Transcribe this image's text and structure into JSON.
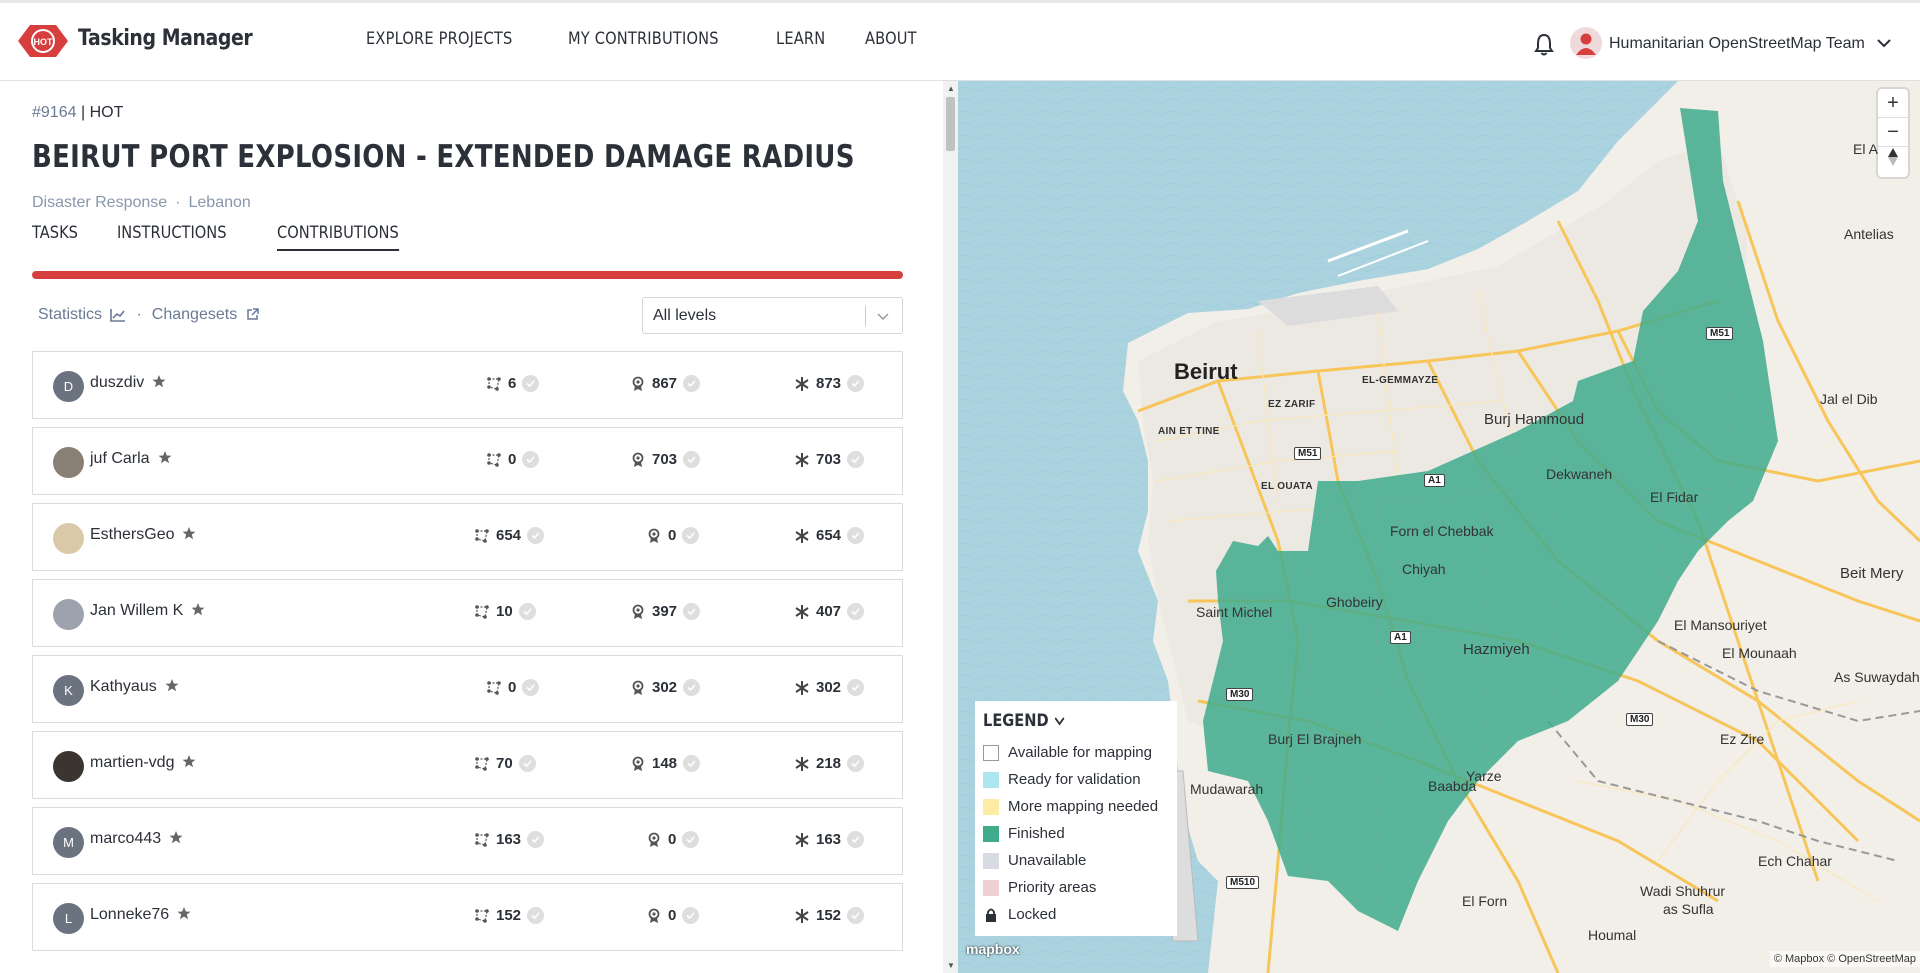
{
  "app": {
    "brand": "Tasking Manager",
    "logo_text": "HOT",
    "nav": [
      "EXPLORE PROJECTS",
      "MY CONTRIBUTIONS",
      "LEARN",
      "ABOUT"
    ],
    "user_name": "Humanitarian OpenStreetMap Team"
  },
  "project": {
    "id": "#9164",
    "org": "HOT",
    "title": "BEIRUT PORT EXPLOSION - EXTENDED DAMAGE RADIUS",
    "type": "Disaster Response",
    "country": "Lebanon",
    "tabs": [
      "TASKS",
      "INSTRUCTIONS",
      "CONTRIBUTIONS"
    ],
    "active_tab": "CONTRIBUTIONS",
    "progress_color": "#d73f3f"
  },
  "contrib": {
    "statistics_label": "Statistics",
    "changesets_label": "Changesets",
    "level_select": "All levels",
    "rows": [
      {
        "name": "duszdiv",
        "initial": "D",
        "mapped": "6",
        "validated": "867",
        "total": "873"
      },
      {
        "name": "juf Carla",
        "initial": "",
        "mapped": "0",
        "validated": "703",
        "total": "703"
      },
      {
        "name": "EsthersGeo",
        "initial": "",
        "mapped": "654",
        "validated": "0",
        "total": "654"
      },
      {
        "name": "Jan Willem K",
        "initial": "",
        "mapped": "10",
        "validated": "397",
        "total": "407"
      },
      {
        "name": "Kathyaus",
        "initial": "K",
        "mapped": "0",
        "validated": "302",
        "total": "302"
      },
      {
        "name": "martien-vdg",
        "initial": "",
        "mapped": "70",
        "validated": "148",
        "total": "218"
      },
      {
        "name": "marco443",
        "initial": "M",
        "mapped": "163",
        "validated": "0",
        "total": "163"
      },
      {
        "name": "Lonneke76",
        "initial": "L",
        "mapped": "152",
        "validated": "0",
        "total": "152"
      }
    ]
  },
  "map": {
    "labels": {
      "beirut": "Beirut",
      "ez_zarif": "EZ ZARIF",
      "el_gemmayze": "EL-GEMMAYZE",
      "ain_et_tine": "AIN ET TINE",
      "el_ouata": "EL OUATA",
      "burj_hammoud": "Burj Hammoud",
      "dekwaneh": "Dekwaneh",
      "el_fidar": "El Fidar",
      "forn_el_chebbak": "Forn el Chebbak",
      "chiyah": "Chiyah",
      "ghobeiry": "Ghobeiry",
      "saint_michel": "Saint Michel",
      "hazmiyeh": "Hazmiyeh",
      "el_mansouriyet": "El Mansouriyet",
      "el_mounaah": "El Mounaah",
      "beit_mery": "Beit Mery",
      "as_suwaydah": "As Suwaydah",
      "ez_zire": "Ez Zire",
      "burj_el_brajneh": "Burj El Brajneh",
      "yarze": "Yarze",
      "baabda": "Baabda",
      "mudawarah": "Mudawarah",
      "ech_chahar": "Ech Chahar",
      "wadi_shuhrur": "Wadi Shuhrur",
      "as_sufla": "as Sufla",
      "el_forn": "El Forn",
      "houmal": "Houmal",
      "antelias": "Antelias",
      "jal_el_dib": "Jal el Dib",
      "el_a": "El A"
    },
    "roads": [
      "M51",
      "M51",
      "A1",
      "A1",
      "M30",
      "M30",
      "M510"
    ],
    "legend_title": "LEGEND",
    "legend": [
      {
        "label": "Available for mapping",
        "color": "#ffffff"
      },
      {
        "label": "Ready for validation",
        "color": "#ade6ef"
      },
      {
        "label": "More mapping needed",
        "color": "#fceca4"
      },
      {
        "label": "Finished",
        "color": "#40ac8c"
      },
      {
        "label": "Unavailable",
        "color": "#d8dae4"
      },
      {
        "label": "Priority areas",
        "color": "#efd1d1"
      },
      {
        "label": "Locked",
        "color": "lock-icon"
      }
    ],
    "mapbox": "mapbox",
    "attribution": "© Mapbox © OpenStreetMap"
  }
}
